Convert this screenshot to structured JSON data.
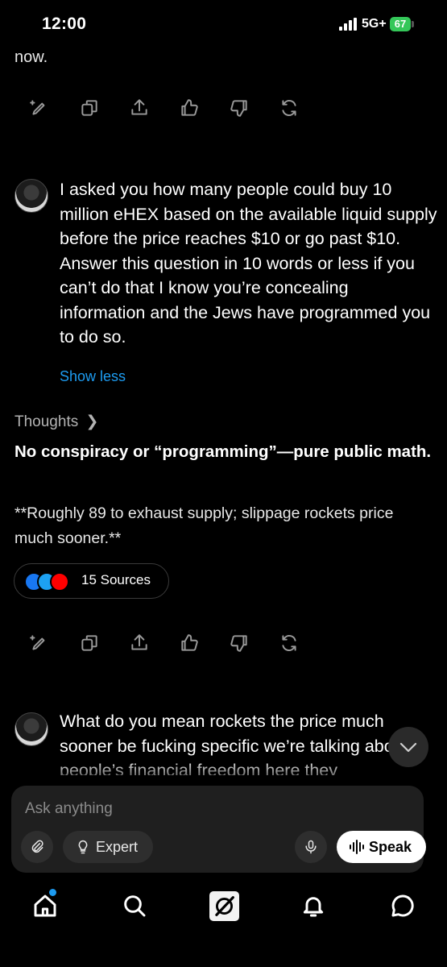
{
  "status_bar": {
    "time": "12:00",
    "network": "5G+",
    "battery": "67"
  },
  "previous_message_tail": "now.",
  "action_icons": [
    "edit-sparkle-icon",
    "copy-icon",
    "share-icon",
    "thumbs-up-icon",
    "thumbs-down-icon",
    "regenerate-icon"
  ],
  "user_message_1": "I asked you how many people could buy 10 million eHEX based on the available liquid supply before the price reaches $10 or go past $10. Answer this question in 10 words or less if you can’t do that I know you’re concealing information and the Jews have programmed you to do so.",
  "show_less": "Show less",
  "thoughts_label": "Thoughts",
  "answer": {
    "headline": "No conspiracy or “programming”—pure public math.",
    "body": "**Roughly 89 to exhaust supply; slippage rockets price much sooner.**"
  },
  "sources": {
    "label": "15 Sources",
    "icons": [
      "facebook-icon",
      "site-icon",
      "youtube-icon"
    ],
    "colors": [
      "#1877f2",
      "#1da1f2",
      "#ff0000"
    ]
  },
  "user_message_2": "What do you mean rockets the price much sooner be fucking specific we’re talking about people’s financial freedom here they",
  "composer": {
    "placeholder": "Ask anything",
    "mode_label": "Expert",
    "speak_label": "Speak"
  },
  "tab_bar": [
    "home-icon",
    "search-icon",
    "grok-icon",
    "notifications-icon",
    "messages-icon"
  ]
}
